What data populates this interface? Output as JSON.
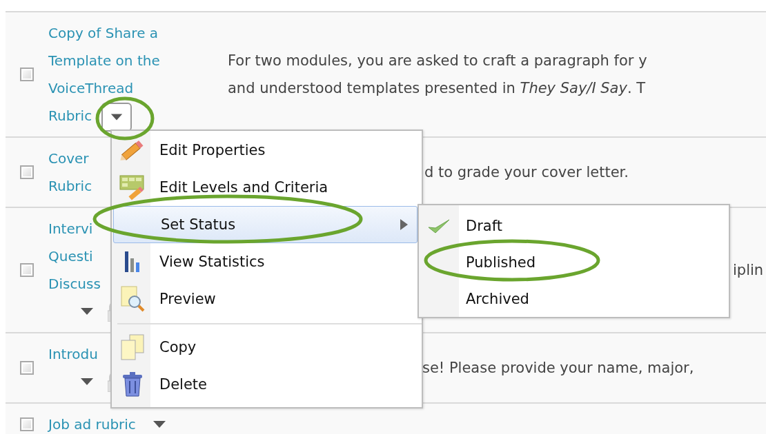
{
  "rows": [
    {
      "kind": "menu-open",
      "checked": false,
      "title_lines": [
        "Copy of Share a",
        "Template on the",
        "VoiceThread",
        "Rubric"
      ],
      "description_lines": [
        "For two modules, you are asked to craft a paragraph for y",
        "and understood templates presented in *They Say/I Say*. T"
      ]
    },
    {
      "kind": "no-caret",
      "checked": false,
      "title_lines": [
        "Cover",
        "Rubric"
      ],
      "description_lines": [
        "d to grade your cover letter."
      ]
    },
    {
      "kind": "locked",
      "checked": false,
      "title_lines": [
        "Intervi",
        "Questi",
        "Discuss"
      ],
      "description_lines": [
        "iplin"
      ]
    },
    {
      "kind": "locked",
      "checked": false,
      "title_lines": [
        "Introdu"
      ],
      "description_lines": [
        "se! Please provide your name, major,"
      ]
    },
    {
      "kind": "inline-caret",
      "checked": false,
      "title_lines": [
        "Job ad rubric"
      ],
      "description_lines": []
    }
  ],
  "menu": {
    "groups": [
      [
        {
          "label": "Edit Properties",
          "selected": false
        },
        {
          "label": "Edit Levels and Criteria",
          "selected": false
        },
        {
          "label": "Set Status",
          "selected": true
        },
        {
          "label": "View Statistics",
          "selected": false
        },
        {
          "label": "Preview",
          "selected": false
        }
      ],
      [
        {
          "label": "Copy",
          "selected": false
        },
        {
          "label": "Delete",
          "selected": false
        }
      ]
    ]
  },
  "status_submenu": {
    "items": [
      {
        "label": "Draft",
        "selected": true
      },
      {
        "label": "Published",
        "selected": false
      },
      {
        "label": "Archived",
        "selected": false
      }
    ]
  }
}
